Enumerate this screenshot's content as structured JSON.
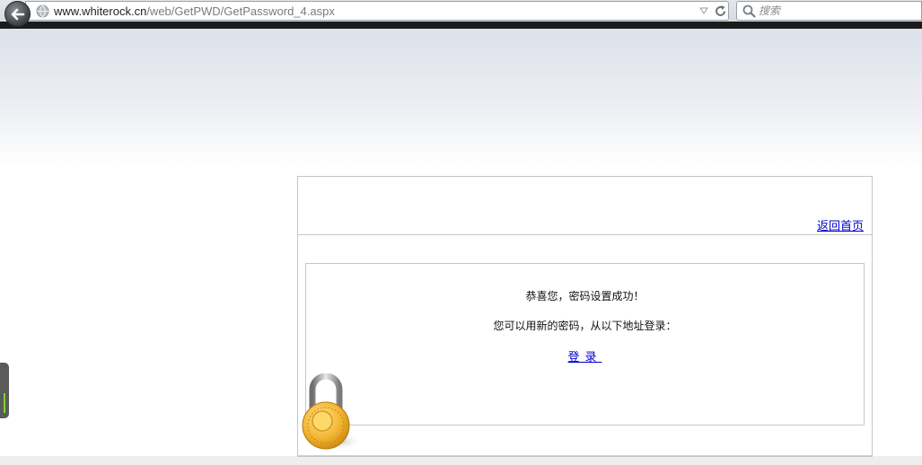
{
  "browser": {
    "url_host": "www.whiterock.cn",
    "url_path": "/web/GetPWD/GetPassword_4.aspx",
    "search_placeholder": "搜索",
    "icons": [
      "back-arrow-icon",
      "globe-icon",
      "dropdown-icon",
      "reload-icon",
      "search-icon"
    ]
  },
  "page": {
    "home_link": "返回首页",
    "message_line1": "恭喜您，密码设置成功！",
    "message_line2": "您可以用新的密码，从以下地址登录：",
    "login_link": "登录",
    "link_color": "#0000cc",
    "icons": [
      "padlock-icon"
    ]
  }
}
